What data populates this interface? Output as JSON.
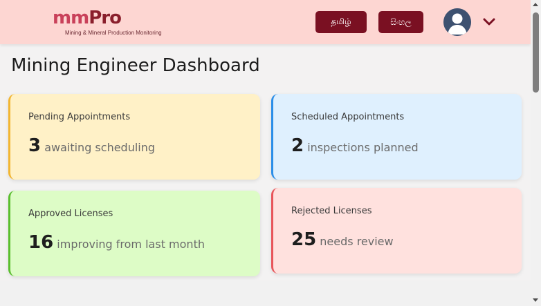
{
  "header": {
    "logo": {
      "mm": "mm",
      "pro": "Pro",
      "subtitle": "Mining & Mineral Production Monitoring"
    },
    "languages": {
      "tamil": "தமிழ்",
      "sinhala": "සිංහල"
    },
    "avatar_icon": "user-avatar-icon",
    "menu_icon": "chevron-down-icon"
  },
  "page": {
    "title": "Mining Engineer Dashboard"
  },
  "cards": [
    {
      "label": "Pending Appointments",
      "value": "3",
      "description": "awaiting scheduling",
      "accent": "#f2b632",
      "background": "#fff1c7"
    },
    {
      "label": "Scheduled Appointments",
      "value": "2",
      "description": "inspections planned",
      "accent": "#2b8ee8",
      "background": "#dff0fe"
    },
    {
      "label": "Approved Licenses",
      "value": "16",
      "description": "improving from last month",
      "accent": "#5bbf2f",
      "background": "#ddfcc6"
    },
    {
      "label": "Rejected Licenses",
      "value": "25",
      "description": "needs review",
      "accent": "#e8555a",
      "background": "#ffe1de"
    }
  ],
  "colors": {
    "header_bg": "#fdd6d2",
    "brand_primary": "#7a1022",
    "brand_accent": "#c9415a"
  }
}
